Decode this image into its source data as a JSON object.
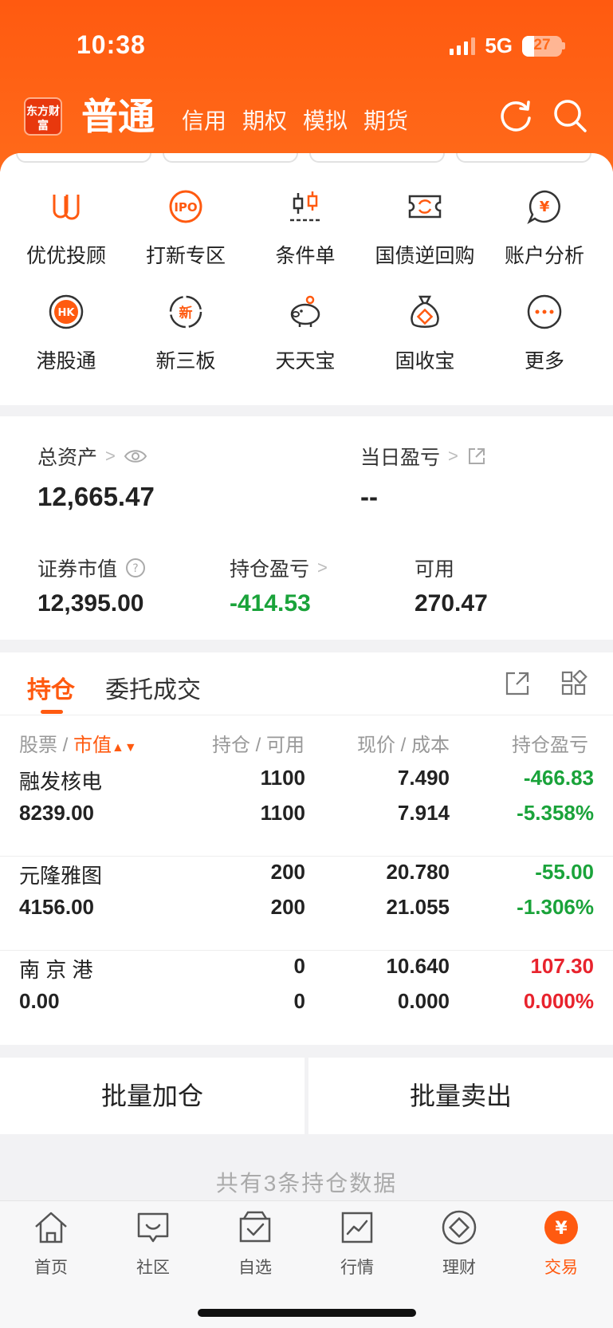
{
  "status_bar": {
    "time": "10:38",
    "network": "5G",
    "battery": "27"
  },
  "header": {
    "logo_text": "东方财富",
    "tabs": [
      {
        "label": "普通",
        "active": true
      },
      {
        "label": "信用"
      },
      {
        "label": "期权"
      },
      {
        "label": "模拟"
      },
      {
        "label": "期货"
      }
    ],
    "icons": [
      "refresh-icon",
      "search-icon"
    ]
  },
  "quick_actions": [
    {
      "label": "优优投顾",
      "icon": "advisor-icon"
    },
    {
      "label": "打新专区",
      "icon": "ipo-icon"
    },
    {
      "label": "条件单",
      "icon": "candlestick-icon"
    },
    {
      "label": "国债逆回购",
      "icon": "repo-ticket-icon"
    },
    {
      "label": "账户分析",
      "icon": "yen-chat-icon"
    },
    {
      "label": "港股通",
      "icon": "hk-icon"
    },
    {
      "label": "新三板",
      "icon": "new-board-icon"
    },
    {
      "label": "天天宝",
      "icon": "piggy-bank-icon"
    },
    {
      "label": "固收宝",
      "icon": "money-bag-icon"
    },
    {
      "label": "更多",
      "icon": "more-dots-icon"
    }
  ],
  "assets": {
    "total_label": "总资产",
    "total_value": "12,665.47",
    "daily_pl_label": "当日盈亏",
    "daily_pl_value": "--",
    "market_value_label": "证券市值",
    "market_value": "12,395.00",
    "holding_pl_label": "持仓盈亏",
    "holding_pl_value": "-414.53",
    "available_label": "可用",
    "available_value": "270.47"
  },
  "positions": {
    "tab_active": "持仓",
    "tab_other": "委托成交",
    "col_stock": "股票",
    "col_mv": "市值",
    "col_hold": "持仓",
    "col_avail": "可用",
    "col_price": "现价",
    "col_cost": "成本",
    "col_pl": "持仓盈亏",
    "rows": [
      {
        "name": "融发核电",
        "market_value": "8239.00",
        "holding": "1100",
        "available": "1100",
        "price": "7.490",
        "cost": "7.914",
        "pl": "-466.83",
        "pl_pct": "-5.358%",
        "trend": "down"
      },
      {
        "name": "元隆雅图",
        "market_value": "4156.00",
        "holding": "200",
        "available": "200",
        "price": "20.780",
        "cost": "21.055",
        "pl": "-55.00",
        "pl_pct": "-1.306%",
        "trend": "down"
      },
      {
        "name": "南 京 港",
        "market_value": "0.00",
        "holding": "0",
        "available": "0",
        "price": "10.640",
        "cost": "0.000",
        "pl": "107.30",
        "pl_pct": "0.000%",
        "trend": "up"
      }
    ],
    "batch_add": "批量加仓",
    "batch_sell": "批量卖出",
    "footer_note": "共有3条持仓数据"
  },
  "bottom_nav": [
    {
      "label": "首页",
      "icon": "home-icon"
    },
    {
      "label": "社区",
      "icon": "community-icon"
    },
    {
      "label": "自选",
      "icon": "watchlist-icon"
    },
    {
      "label": "行情",
      "icon": "market-chart-icon"
    },
    {
      "label": "理财",
      "icon": "wealth-icon"
    },
    {
      "label": "交易",
      "icon": "trade-yen-icon",
      "active": true
    }
  ],
  "colors": {
    "brand": "#ff5a10",
    "gain": "#e8232d",
    "loss": "#1aa33a"
  }
}
